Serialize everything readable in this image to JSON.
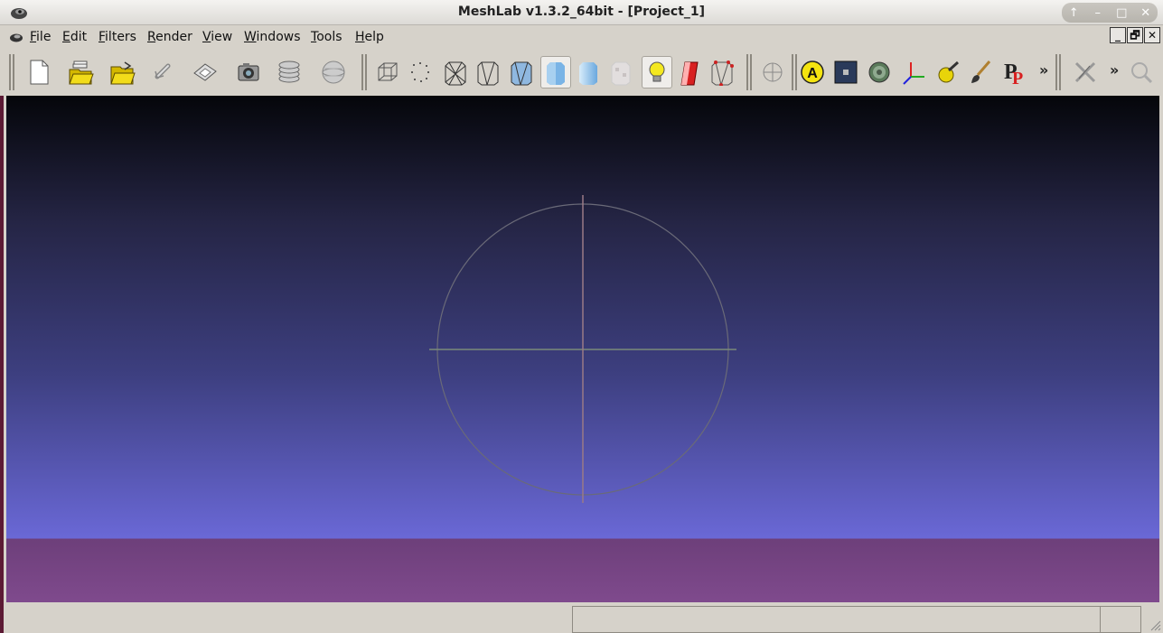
{
  "window": {
    "title": "MeshLab v1.3.2_64bit - [Project_1]",
    "controls": [
      "↑",
      "–",
      "□",
      "✕"
    ]
  },
  "menubar": {
    "items": [
      "File",
      "Edit",
      "Filters",
      "Render",
      "View",
      "Windows",
      "Tools",
      "Help"
    ]
  },
  "mdi_controls": [
    "_",
    "🗗",
    "✕"
  ],
  "toolbar": {
    "groups": [
      [
        "new-project",
        "open-project",
        "import-mesh",
        "reload",
        "export-mesh",
        "snapshot",
        "layers",
        "sphere-view"
      ],
      [
        "bounding-box",
        "points",
        "wireframe",
        "hidden-lines",
        "flat-lines",
        "flat",
        "smooth",
        "texture",
        "light",
        "backface",
        "vertex-select"
      ],
      [
        "trackball"
      ],
      [
        "annotation-a",
        "texture-box",
        "globe-color",
        "axes",
        "lock",
        "paint",
        "pp-logo"
      ],
      [
        "select-cross"
      ]
    ],
    "more_label": "»",
    "accent_yellow": "#e8d40a",
    "accent_red": "#d82020"
  },
  "viewport": {
    "background_top": "#05060a",
    "background_bottom": "#6a68d6",
    "floor_color": "#7a4588"
  },
  "status": {
    "text": ""
  }
}
